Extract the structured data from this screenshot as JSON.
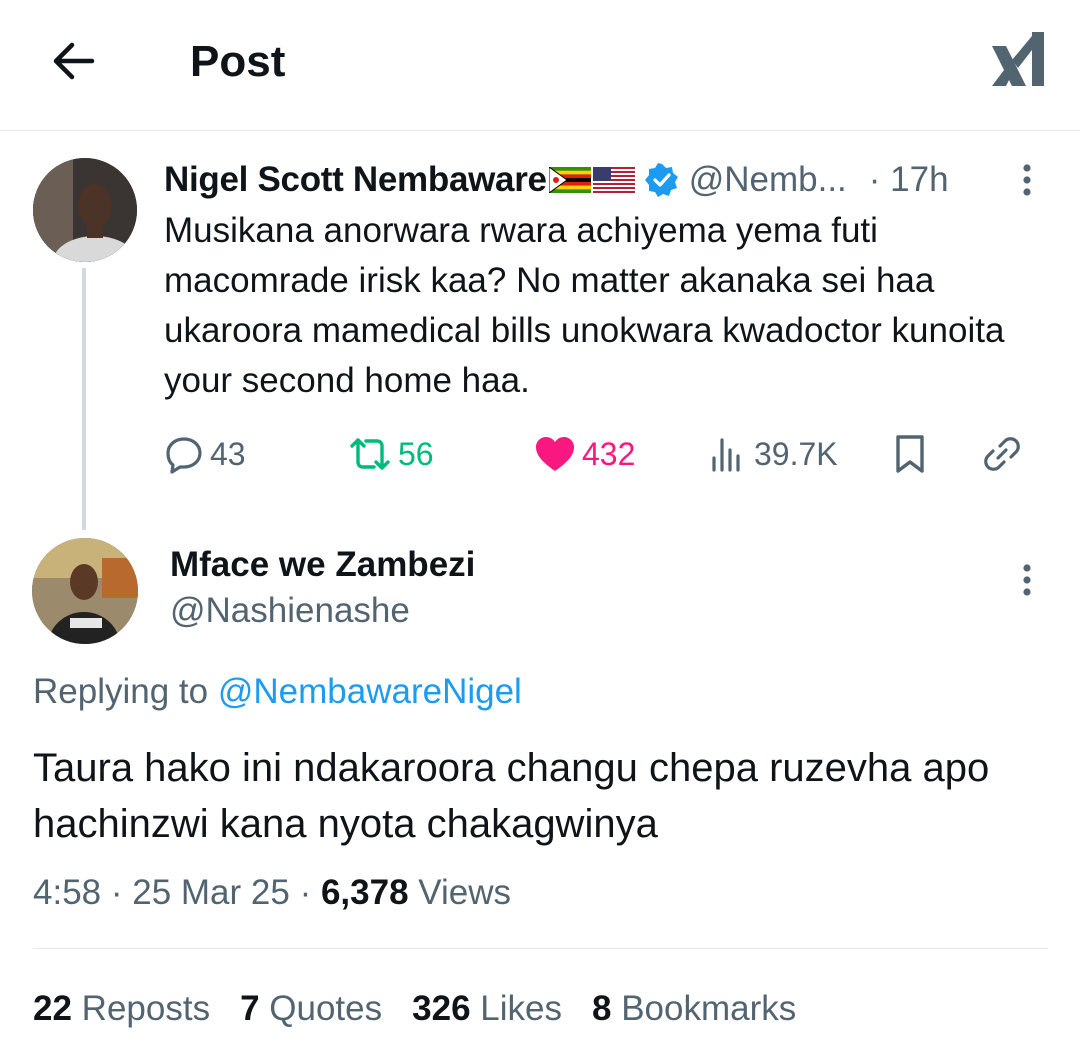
{
  "header": {
    "title": "Post"
  },
  "parent_tweet": {
    "display_name": "Nigel Scott Nembaware",
    "handle": "@Nemb...",
    "time": "· 17h",
    "text": "Musikana anorwara rwara achiyema yema futi macomrade irisk kaa? No matter akanaka sei haa ukaroora mamedical bills unokwara kwadoctor kunoita your second home haa.",
    "replies": "43",
    "reposts": "56",
    "likes": "432",
    "views": "39.7K",
    "verified_color": "#1d9bf0",
    "repost_color": "#00ba7c",
    "like_color": "#f91880"
  },
  "reply_tweet": {
    "display_name": "Mface we Zambezi",
    "handle": "@Nashienashe",
    "replying_prefix": "Replying to",
    "replying_handle": "@NembawareNigel",
    "text": "Taura hako ini ndakaroora changu chepa ruzevha apo hachinzwi kana nyota chakagwinya",
    "time": "4:58",
    "sep1": "·",
    "date": "25 Mar 25",
    "sep2": "·",
    "views_count": "6,378",
    "views_label": "Views",
    "stats": {
      "reposts_count": "22",
      "reposts_label": "Reposts",
      "quotes_count": "7",
      "quotes_label": "Quotes",
      "likes_count": "326",
      "likes_label": "Likes",
      "bookmarks_count": "8",
      "bookmarks_label": "Bookmarks"
    }
  },
  "icons": [
    "back-arrow-icon",
    "xai-logo-icon",
    "verified-icon",
    "more-icon",
    "reply-icon",
    "repost-icon",
    "like-icon",
    "views-icon",
    "bookmark-icon",
    "share-icon"
  ]
}
